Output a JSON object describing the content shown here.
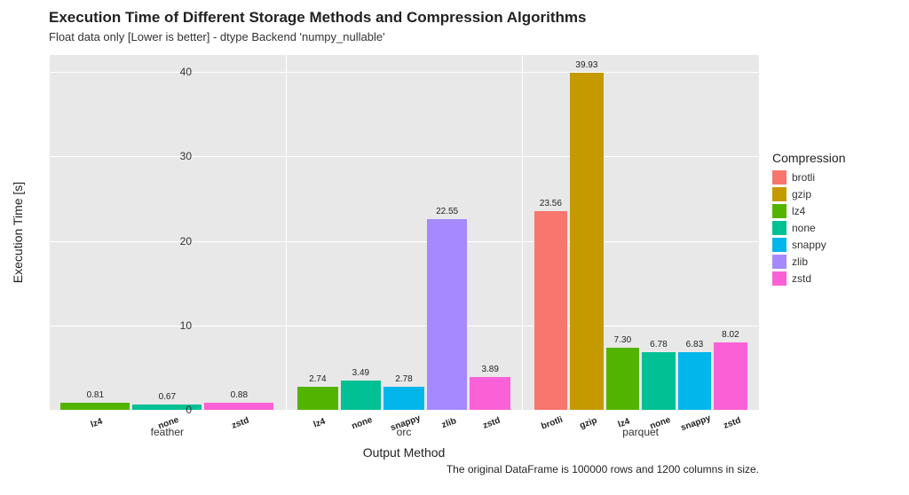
{
  "chart_data": {
    "type": "bar",
    "title": "Execution Time of Different Storage Methods and Compression Algorithms",
    "subtitle": "Float data only [Lower is better] - dtype Backend 'numpy_nullable'",
    "xlabel": "Output Method",
    "ylabel": "Execution Time [s]",
    "caption": "The original DataFrame is 100000 rows and 1200 columns in size.",
    "ylim": [
      0,
      42
    ],
    "y_ticks": [
      0,
      10,
      20,
      30,
      40
    ],
    "legend_title": "Compression",
    "colors": {
      "brotli": "#f8766d",
      "gzip": "#c49a00",
      "lz4": "#53b400",
      "none": "#00c094",
      "snappy": "#00b6eb",
      "zlib": "#a58aff",
      "zstd": "#fb61d7"
    },
    "legend_order": [
      "brotli",
      "gzip",
      "lz4",
      "none",
      "snappy",
      "zlib",
      "zstd"
    ],
    "groups": [
      {
        "name": "feather",
        "bars": [
          {
            "comp": "lz4",
            "value": 0.81
          },
          {
            "comp": "none",
            "value": 0.67
          },
          {
            "comp": "zstd",
            "value": 0.88
          }
        ]
      },
      {
        "name": "orc",
        "bars": [
          {
            "comp": "lz4",
            "value": 2.74
          },
          {
            "comp": "none",
            "value": 3.49
          },
          {
            "comp": "snappy",
            "value": 2.78
          },
          {
            "comp": "zlib",
            "value": 22.55
          },
          {
            "comp": "zstd",
            "value": 3.89
          }
        ]
      },
      {
        "name": "parquet",
        "bars": [
          {
            "comp": "brotli",
            "value": 23.56
          },
          {
            "comp": "gzip",
            "value": 39.93
          },
          {
            "comp": "lz4",
            "value": 7.3
          },
          {
            "comp": "none",
            "value": 6.78
          },
          {
            "comp": "snappy",
            "value": 6.83
          },
          {
            "comp": "zstd",
            "value": 8.02
          }
        ]
      }
    ]
  }
}
